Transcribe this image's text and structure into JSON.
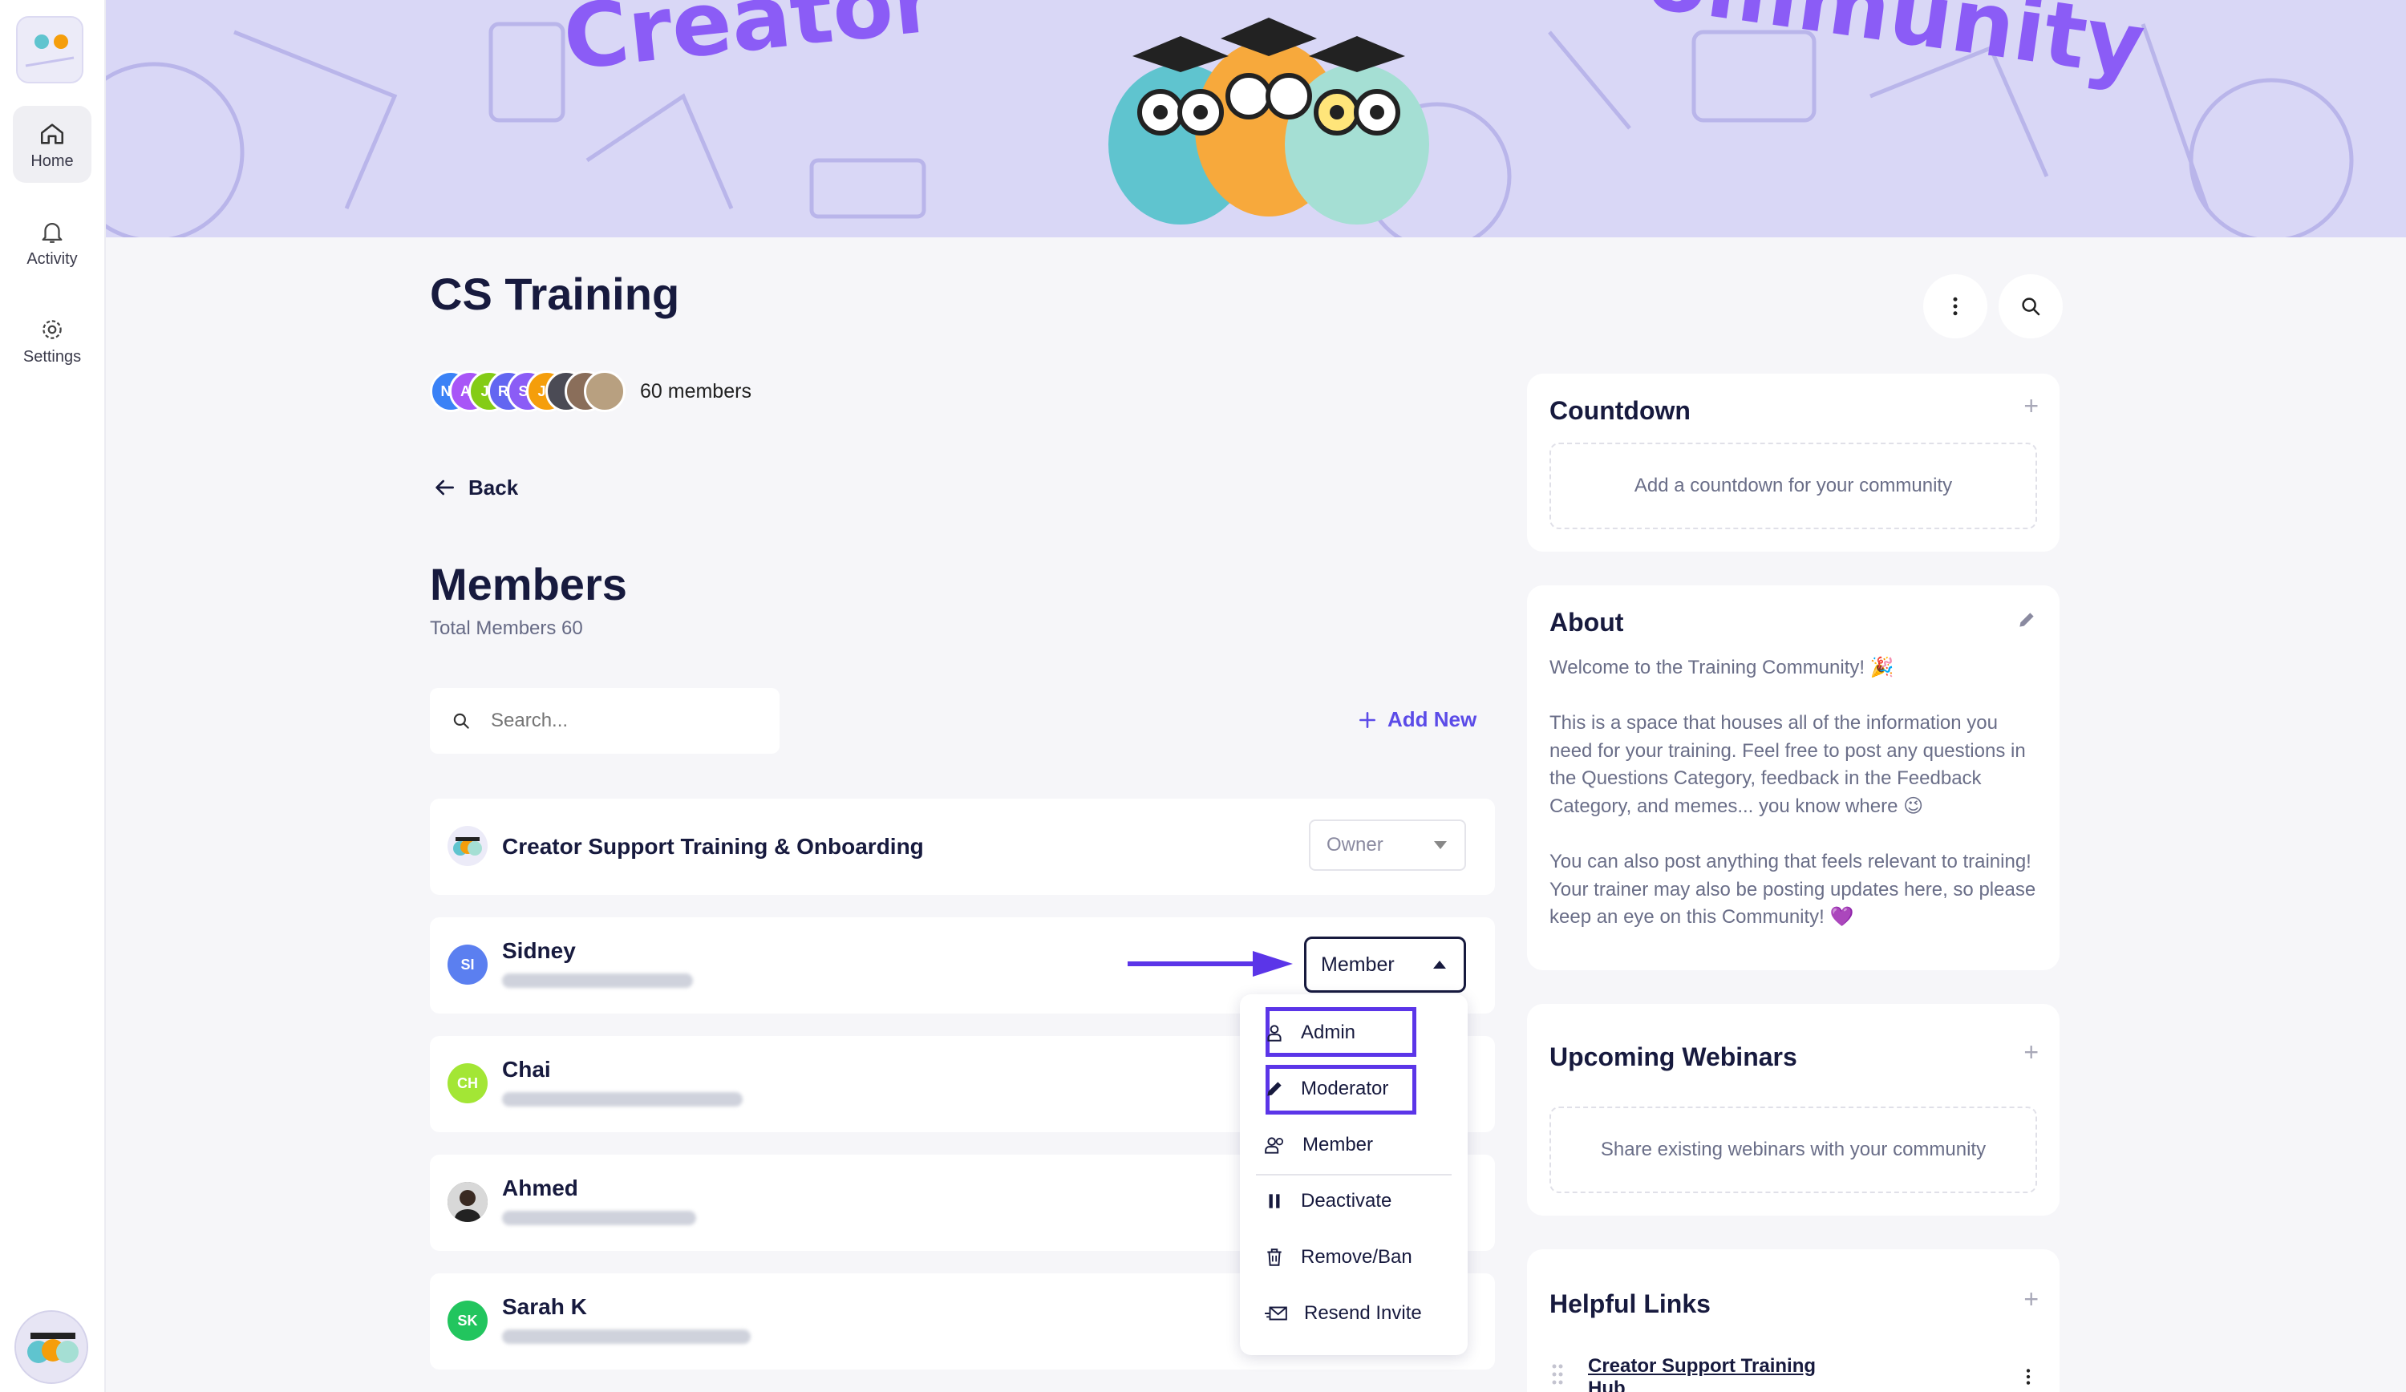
{
  "sidebar": {
    "items": [
      {
        "label": "Home",
        "icon": "home-icon"
      },
      {
        "label": "Activity",
        "icon": "bell-icon"
      },
      {
        "label": "Settings",
        "icon": "gear-icon"
      }
    ]
  },
  "banner": {
    "text_left": "Creator",
    "text_right": "ommunity",
    "bg": "#d9d7f6",
    "text_color": "#8b5cf6"
  },
  "community": {
    "title": "CS Training",
    "avatars": [
      {
        "initials": "NP",
        "color": "#3b82f6"
      },
      {
        "initials": "AL",
        "color": "#a855f7"
      },
      {
        "initials": "JL",
        "color": "#84cc16"
      },
      {
        "initials": "RA",
        "color": "#6366f1"
      },
      {
        "initials": "ST",
        "color": "#8b5cf6"
      },
      {
        "initials": "JU",
        "color": "#f59e0b"
      }
    ],
    "members_count": "60 members"
  },
  "nav": {
    "back": "Back"
  },
  "members": {
    "heading": "Members",
    "total": "Total Members 60",
    "search_placeholder": "Search...",
    "add_new": "Add New",
    "list": [
      {
        "name": "Creator Support Training & Onboarding",
        "role": "Owner"
      },
      {
        "name": "Sidney",
        "initials": "SI",
        "color": "#5b7ff0",
        "role": "Member"
      },
      {
        "name": "Chai",
        "initials": "CH",
        "color": "#a3e635"
      },
      {
        "name": "Ahmed"
      },
      {
        "name": "Sarah K",
        "initials": "SK",
        "color": "#22c55e"
      }
    ]
  },
  "role_menu": {
    "items": [
      {
        "label": "Admin",
        "icon": "user-icon"
      },
      {
        "label": "Moderator",
        "icon": "pencil-icon"
      },
      {
        "label": "Member",
        "icon": "users-icon"
      },
      {
        "label": "Deactivate",
        "icon": "pause-icon"
      },
      {
        "label": "Remove/Ban",
        "icon": "trash-icon"
      },
      {
        "label": "Resend Invite",
        "icon": "mail-send-icon"
      }
    ],
    "highlight_color": "#5b35e8"
  },
  "right": {
    "countdown": {
      "title": "Countdown",
      "empty": "Add a countdown for your community"
    },
    "about": {
      "title": "About",
      "p1": "Welcome to the Training Community! 🎉",
      "p2": "This is a space that houses all of the information you need for your training. Feel free to post any questions in the Questions Category, feedback in the Feedback Category, and memes... you know where 😉",
      "p3": "You can also post anything that feels relevant to training! Your trainer may also be posting updates here, so please keep an eye on this Community! 💜"
    },
    "webinars": {
      "title": "Upcoming Webinars",
      "empty": "Share existing webinars with your community"
    },
    "links": {
      "title": "Helpful Links",
      "item": "Creator Support Training Hub"
    }
  }
}
